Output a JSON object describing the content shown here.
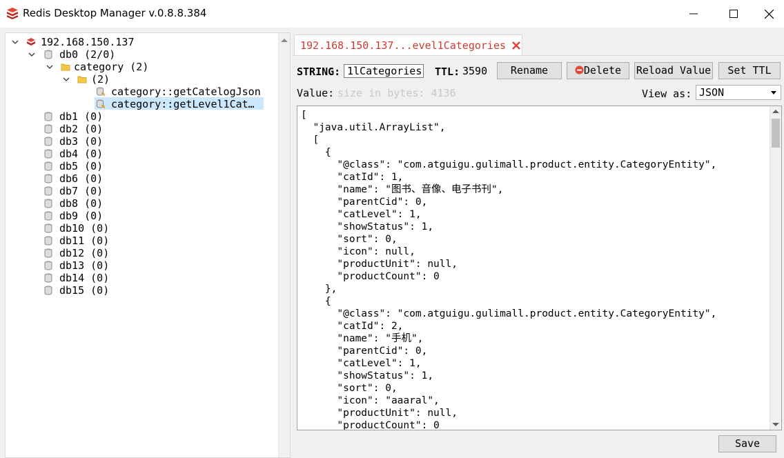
{
  "window": {
    "title": "Redis Desktop Manager v.0.8.8.384"
  },
  "tree": {
    "server": "192.168.150.137",
    "db0": "db0  (2/0)",
    "folder": "category (2)",
    "subfolder": " (2)",
    "keys": [
      "category::getCatelogJson",
      "category::getLevel1Cat…"
    ],
    "dbs": [
      "db1 (0)",
      "db2 (0)",
      "db3 (0)",
      "db4 (0)",
      "db5 (0)",
      "db6 (0)",
      "db7 (0)",
      "db8 (0)",
      "db9 (0)",
      "db10 (0)",
      "db11 (0)",
      "db12 (0)",
      "db13 (0)",
      "db14 (0)",
      "db15 (0)"
    ]
  },
  "tab": {
    "label": "192.168.150.137...evel1Categories"
  },
  "key_bar": {
    "type_label": "STRING:",
    "key_value": "1lCategories",
    "ttl_label": "TTL:",
    "ttl_value": "3590",
    "rename": "Rename",
    "delete": "Delete",
    "reload": "Reload Value",
    "set_ttl": "Set TTL"
  },
  "value_bar": {
    "value_label": "Value:",
    "size_placeholder": "size in bytes: 4136",
    "view_as_label": "View as:",
    "view_as_value": "JSON"
  },
  "editor": {
    "content": "[\n  \"java.util.ArrayList\",\n  [\n    {\n      \"@class\": \"com.atguigu.gulimall.product.entity.CategoryEntity\",\n      \"catId\": 1,\n      \"name\": \"图书、音像、电子书刊\",\n      \"parentCid\": 0,\n      \"catLevel\": 1,\n      \"showStatus\": 1,\n      \"sort\": 0,\n      \"icon\": null,\n      \"productUnit\": null,\n      \"productCount\": 0\n    },\n    {\n      \"@class\": \"com.atguigu.gulimall.product.entity.CategoryEntity\",\n      \"catId\": 2,\n      \"name\": \"手机\",\n      \"parentCid\": 0,\n      \"catLevel\": 1,\n      \"showStatus\": 1,\n      \"sort\": 0,\n      \"icon\": \"aaaral\",\n      \"productUnit\": null,\n      \"productCount\": 0"
  },
  "save": "Save",
  "colors": {
    "tab_text": "#d03a2f",
    "selection": "#cce8ff",
    "redis_red": "#c0312a"
  }
}
